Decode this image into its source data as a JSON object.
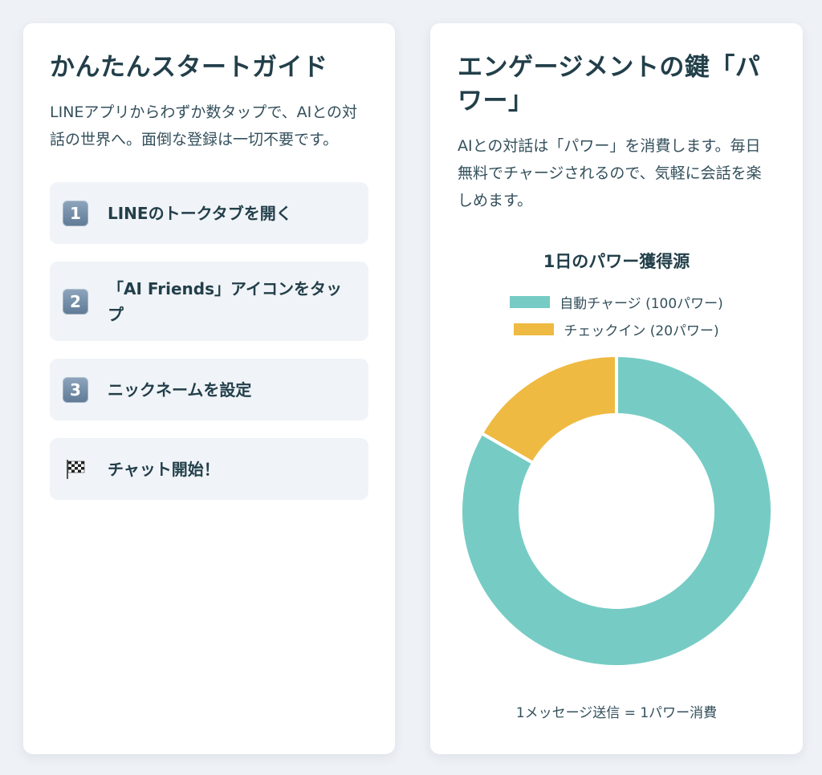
{
  "left_card": {
    "title": "かんたんスタートガイド",
    "description": "LINEアプリからわずか数タップで、AIとの対話の世界へ。面倒な登録は一切不要です。",
    "steps": [
      {
        "badge": "1",
        "icon": "keycap-1-icon",
        "label": "LINEのトークタブを開く"
      },
      {
        "badge": "2",
        "icon": "keycap-2-icon",
        "label": "「AI Friends」アイコンをタップ"
      },
      {
        "badge": "3",
        "icon": "keycap-3-icon",
        "label": "ニックネームを設定"
      },
      {
        "badge": "",
        "icon": "checkered-flag-icon",
        "label": "チャット開始！"
      }
    ]
  },
  "right_card": {
    "title": "エンゲージメントの鍵「パワー」",
    "description": "AIとの対話は「パワー」を消費します。毎日無料でチャージされるので、気軽に会話を楽しめます。",
    "footer": "1メッセージ送信 = 1パワー消費"
  },
  "chart_data": {
    "type": "pie",
    "title": "1日のパワー獲得源",
    "donut": true,
    "legend_position": "top",
    "categories": [
      "自動チャージ (100パワー)",
      "チェックイン (20パワー)"
    ],
    "values": [
      100,
      20
    ],
    "colors": [
      "#76ccc4",
      "#efba42"
    ]
  }
}
